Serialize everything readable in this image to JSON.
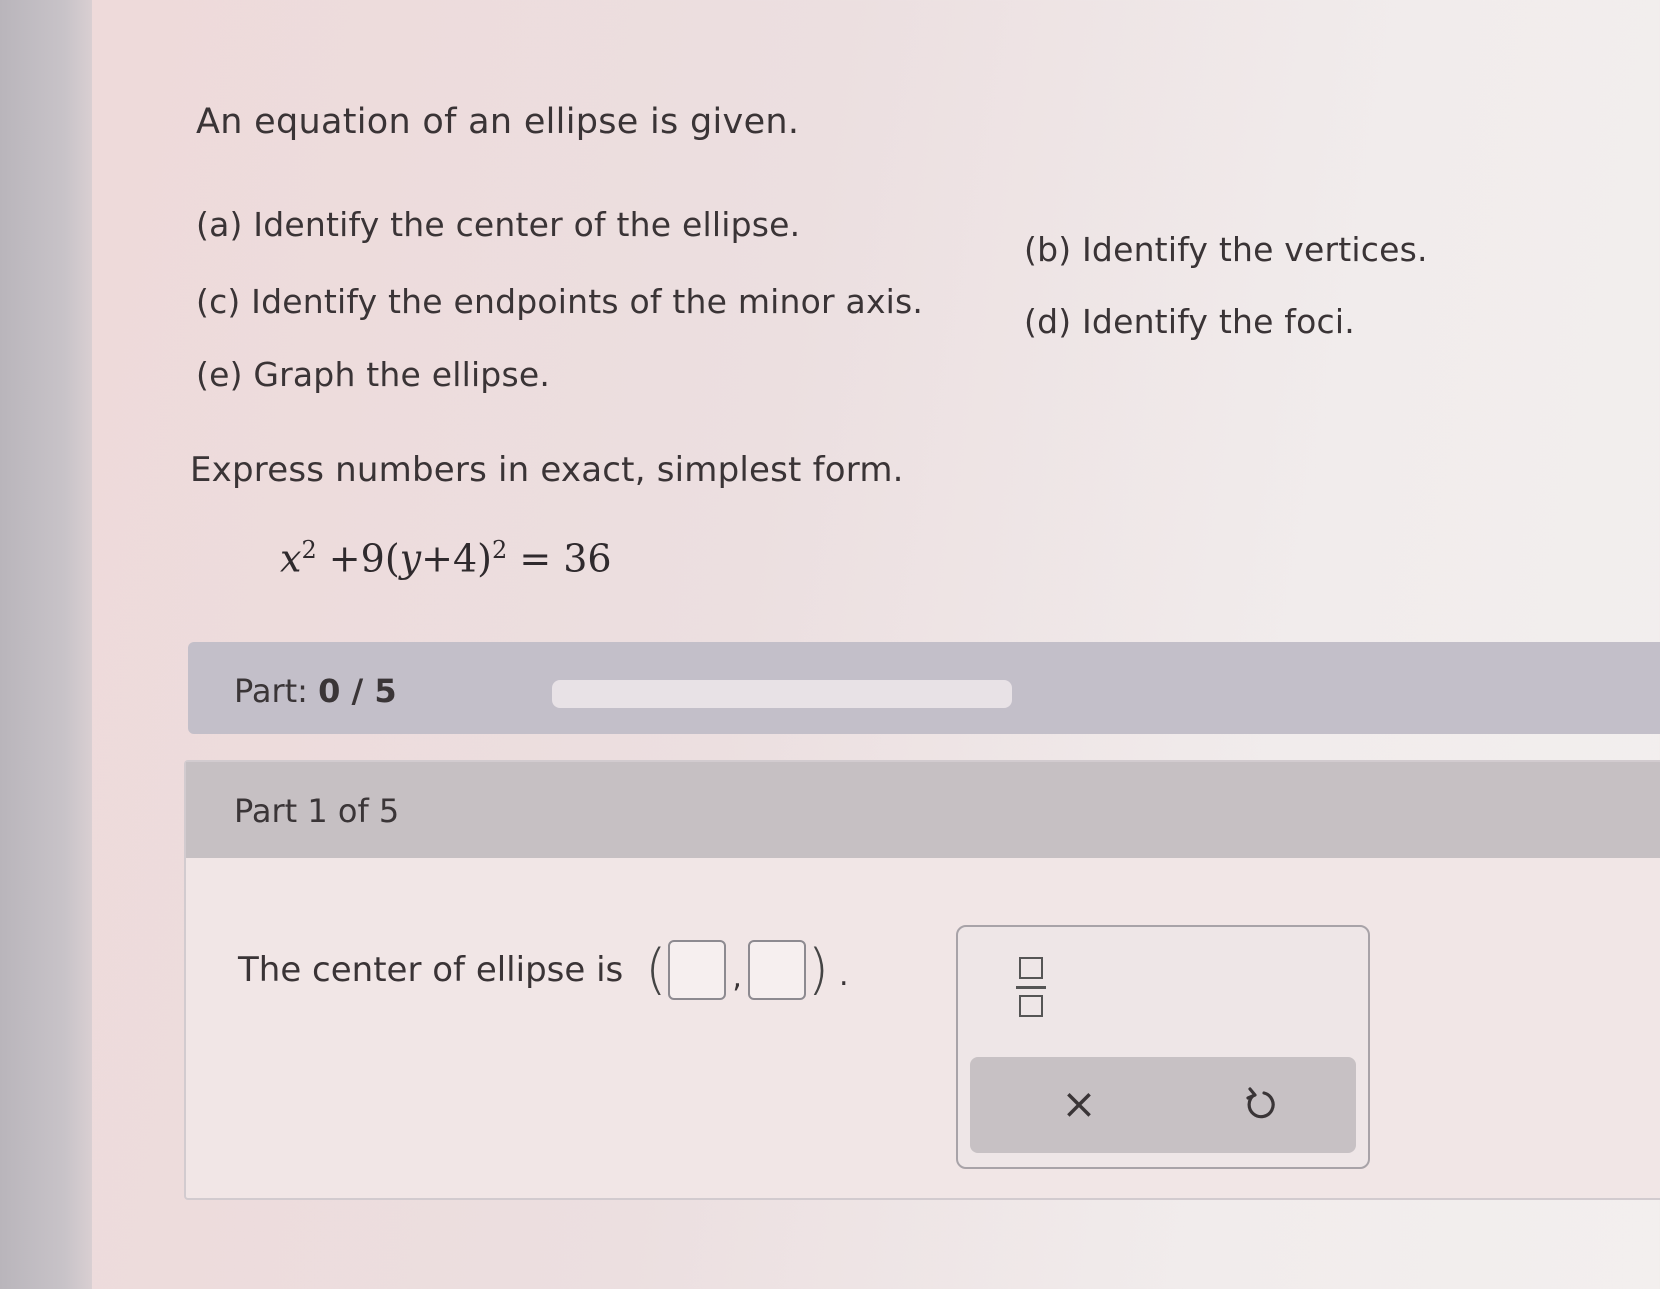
{
  "problem": {
    "intro": "An equation of an ellipse is given.",
    "tasks": {
      "a": "(a) Identify the center of the ellipse.",
      "b": "(b) Identify the vertices.",
      "c": "(c) Identify the endpoints of the minor axis.",
      "d": "(d) Identify the foci.",
      "e": "(e) Graph the ellipse."
    },
    "instruction": "Express numbers in exact, simplest form.",
    "equation": {
      "x": "x",
      "x_exp": "2",
      "middle": " +9(",
      "y": "y",
      "inner": "+4)",
      "y_exp": "2",
      "rhs": " = 36"
    }
  },
  "progress": {
    "label": "Part:",
    "value": "0 / 5",
    "fraction": 0
  },
  "part": {
    "title": "Part 1 of 5",
    "question_text": "The center of ellipse is",
    "comma": ",",
    "period": "."
  },
  "toolbox": {
    "fraction_tool": "fraction-icon",
    "clear_label": "×",
    "undo_tool": "undo-icon"
  }
}
